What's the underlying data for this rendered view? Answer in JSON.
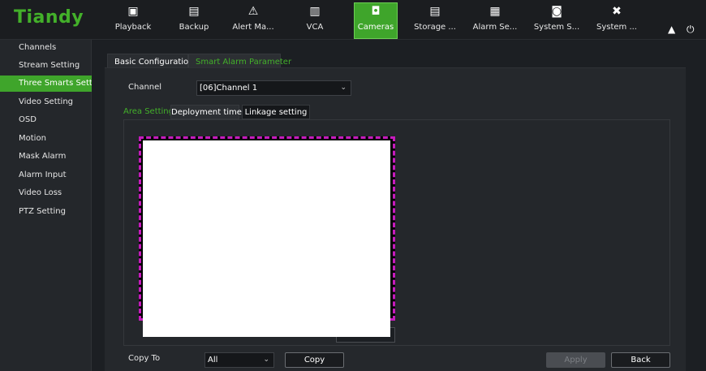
{
  "brand": {
    "logo": "Tiandy",
    "accent": "#43b02a"
  },
  "nav": [
    {
      "id": "playback",
      "icon": "playback-icon",
      "glyph": "▣",
      "label": "Playback"
    },
    {
      "id": "backup",
      "icon": "backup-icon",
      "glyph": "🖫",
      "label": "Backup"
    },
    {
      "id": "alert",
      "icon": "alert-icon",
      "glyph": "⚠",
      "label": "Alert Ma..."
    },
    {
      "id": "vca",
      "icon": "vca-icon",
      "glyph": "▥",
      "label": "VCA"
    },
    {
      "id": "cameras",
      "icon": "camera-icon",
      "glyph": "◘",
      "label": "Cameras"
    },
    {
      "id": "storage",
      "icon": "storage-icon",
      "glyph": "▤",
      "label": "Storage ..."
    },
    {
      "id": "alarmset",
      "icon": "alarm-settings-icon",
      "glyph": "▦",
      "label": "Alarm Se..."
    },
    {
      "id": "systemsettings",
      "icon": "system-settings-icon",
      "glyph": "◙",
      "label": "System S..."
    },
    {
      "id": "systemtools",
      "icon": "system-tools-icon",
      "glyph": "✖",
      "label": "System ..."
    }
  ],
  "active_nav": "cameras",
  "top_icons": {
    "bell": "bell-icon",
    "power": "power-icon"
  },
  "sidebar": {
    "items": [
      {
        "label": "Channels"
      },
      {
        "label": "Stream Setting"
      },
      {
        "label": "Three Smarts Sett..."
      },
      {
        "label": "Video Setting"
      },
      {
        "label": "OSD"
      },
      {
        "label": "Motion"
      },
      {
        "label": "Mask Alarm"
      },
      {
        "label": "Alarm Input"
      },
      {
        "label": "Video Loss"
      },
      {
        "label": "PTZ Setting"
      }
    ],
    "active_index": 2
  },
  "tabs": {
    "basic": "Basic Configuration",
    "smart": "Smart Alarm Parameter"
  },
  "channel": {
    "label": "Channel",
    "value": "[06]Channel 1"
  },
  "subtabs": {
    "area": "Area Setting",
    "deployment": "Deployment time",
    "linkage": "Linkage setting"
  },
  "footer": {
    "copy_to_label": "Copy To",
    "copy_to_value": "All",
    "copy_button": "Copy",
    "apply_button": "Apply",
    "back_button": "Back"
  }
}
